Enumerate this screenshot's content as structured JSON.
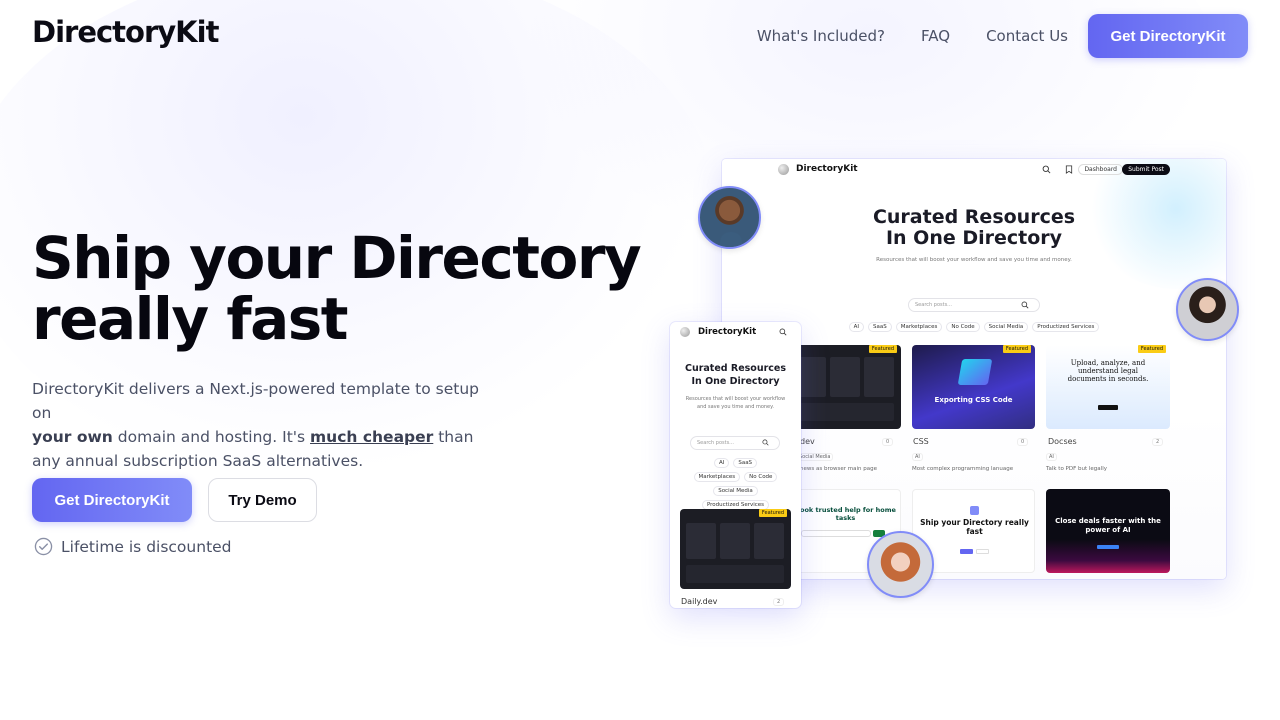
{
  "header": {
    "logo": "DirectoryKit",
    "nav": [
      "What's Included?",
      "FAQ",
      "Contact Us"
    ],
    "cta_label": "Get DirectoryKit"
  },
  "hero": {
    "title_line1": "Ship your Directory",
    "title_line2": "really fast",
    "desc_part1": "DirectoryKit delivers a Next.js-powered template to setup on",
    "desc_bold1": "your own",
    "desc_part2": " domain and hosting. It's ",
    "desc_bold2": "much cheaper",
    "desc_part3": " than",
    "desc_part4": "any annual subscription SaaS alternatives.",
    "primary_cta": "Get DirectoryKit",
    "secondary_cta": "Try Demo",
    "lifetime_note": "Lifetime is discounted"
  },
  "mockup_desktop": {
    "logo": "DirectoryKit",
    "dashboard": "Dashboard",
    "submit": "Submit Post",
    "heading_line1": "Curated Resources",
    "heading_line2": "In One Directory",
    "subheading": "Resources that will boost your workflow and save you time and money.",
    "search_placeholder": "Search posts...",
    "chips": [
      "AI",
      "SaaS",
      "Marketplaces",
      "No Code",
      "Social Media",
      "Productized Services"
    ],
    "featured": "Featured",
    "cards": [
      {
        "title": "dev",
        "tag": "Social Media",
        "desc": "r news as browser main page",
        "votes": "0"
      },
      {
        "title": "CSS",
        "tag": "AI",
        "desc": "Most complex programming lanuage",
        "votes": "0",
        "image_text": "Exporting CSS Code"
      },
      {
        "title": "Docses",
        "tag": "AI",
        "desc": "Talk to PDF but legally",
        "votes": "2",
        "image_text": "Upload, analyze, and understand legal documents in seconds."
      }
    ],
    "row2": [
      {
        "image_text": "Book trusted help for home tasks"
      },
      {
        "image_text": "Ship your Directory really fast"
      },
      {
        "image_text": "Close deals faster with the power of AI"
      }
    ]
  },
  "mockup_mobile": {
    "logo": "DirectoryKit",
    "heading_line1": "Curated Resources",
    "heading_line2": "In One Directory",
    "subheading": "Resources that will boost your workflow and save you time and money.",
    "search_placeholder": "Search posts...",
    "chips": [
      "AI",
      "SaaS",
      "Marketplaces",
      "No Code",
      "Social Media",
      "Productized Services"
    ],
    "featured": "Featured",
    "card_title": "Daily.dev",
    "votes": "2"
  },
  "colors": {
    "accent_start": "#6366f1",
    "accent_end": "#818cf8",
    "text_dark": "#0b0b14",
    "text_muted": "#4b5166",
    "featured": "#facc15"
  }
}
